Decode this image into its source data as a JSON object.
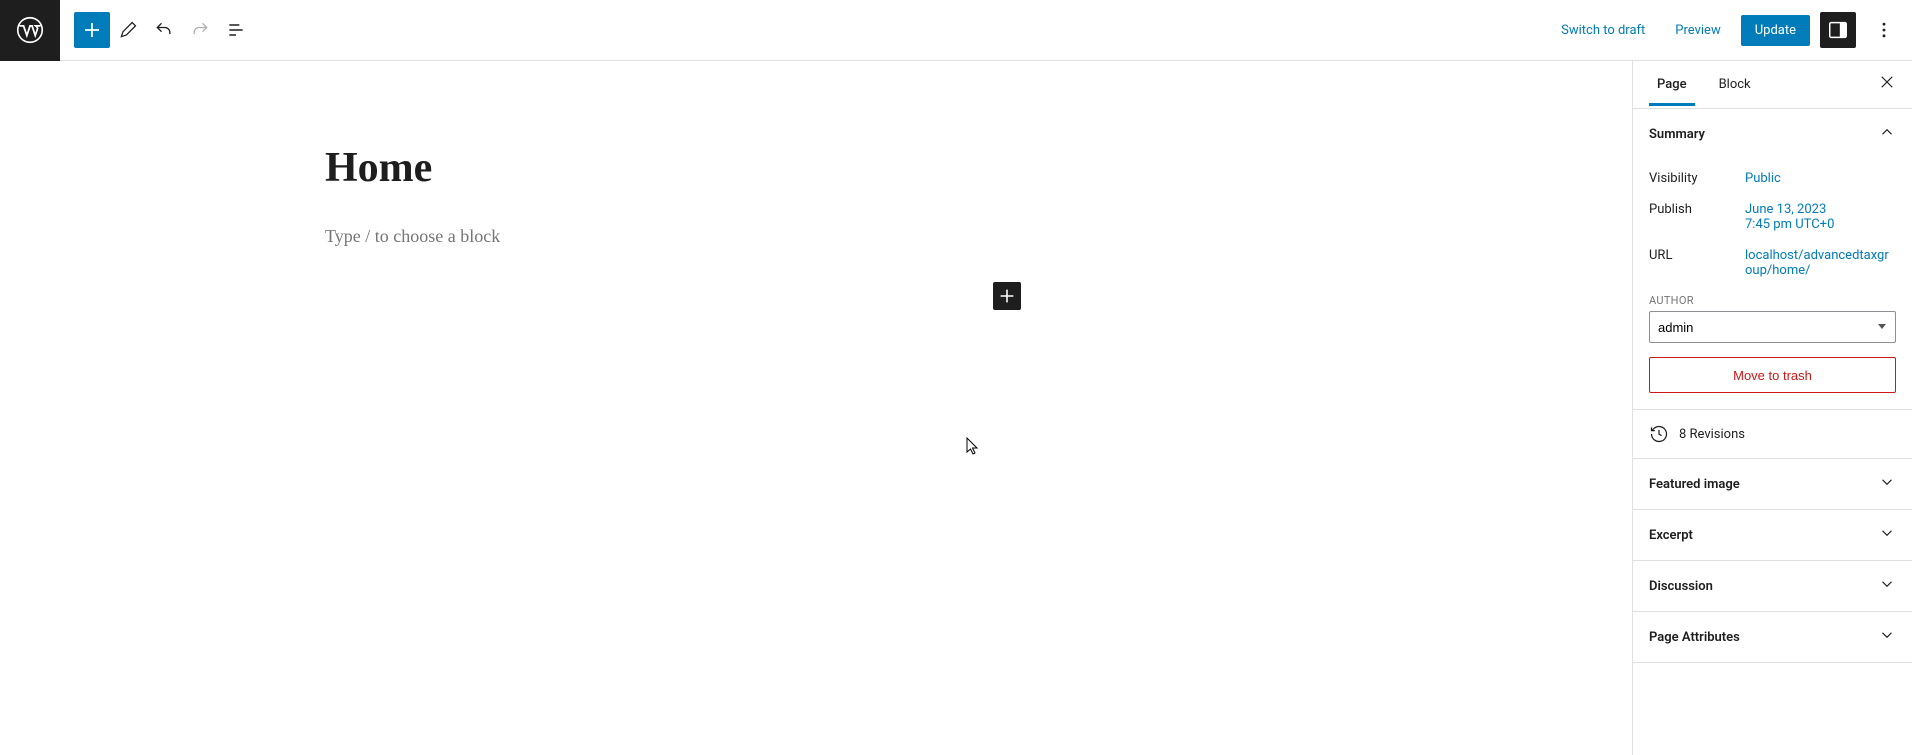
{
  "toolbar": {
    "switch_to_draft": "Switch to draft",
    "preview": "Preview",
    "update": "Update"
  },
  "editor": {
    "title": "Home",
    "placeholder": "Type / to choose a block"
  },
  "sidebar": {
    "tabs": {
      "page": "Page",
      "block": "Block"
    },
    "summary": {
      "title": "Summary",
      "visibility_label": "Visibility",
      "visibility_value": "Public",
      "publish_label": "Publish",
      "publish_value_line1": "June 13, 2023",
      "publish_value_line2": "7:45 pm UTC+0",
      "url_label": "URL",
      "url_value": "localhost/advancedtaxgroup/home/",
      "author_label": "AUTHOR",
      "author_value": "admin",
      "move_to_trash": "Move to trash"
    },
    "revisions": "8 Revisions",
    "featured_image": "Featured image",
    "excerpt": "Excerpt",
    "discussion": "Discussion",
    "page_attributes": "Page Attributes"
  }
}
